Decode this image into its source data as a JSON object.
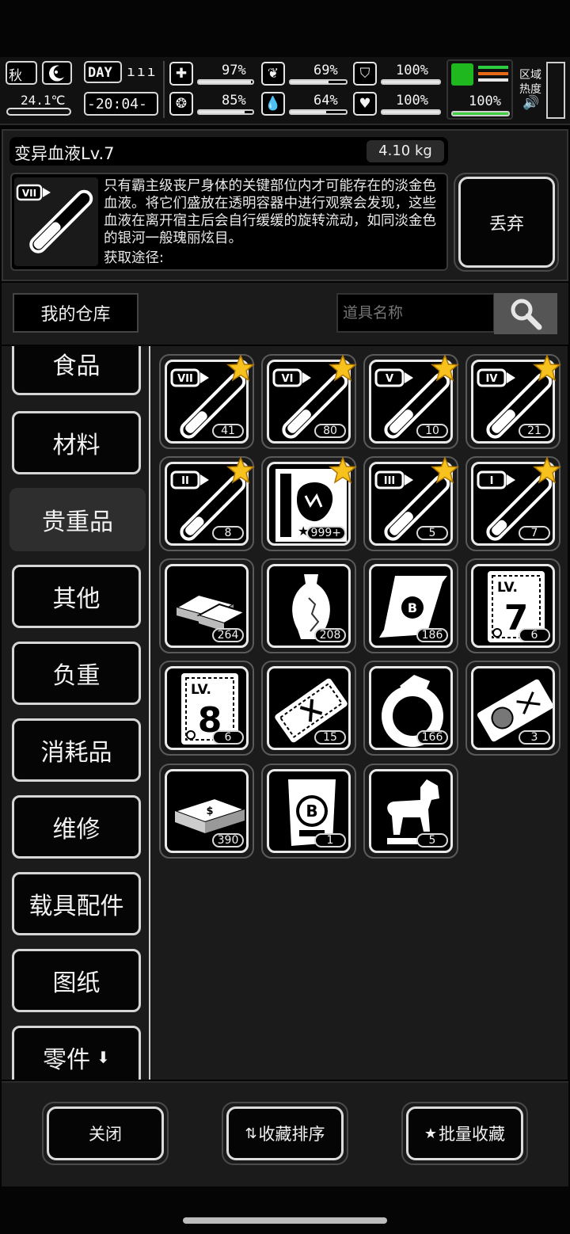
{
  "status": {
    "season": "秋",
    "temperature": "24.1℃",
    "day_label": "DAY",
    "time": "-20:04-",
    "health_pct": "97%",
    "hunger_pct": "69%",
    "sanity_pct": "85%",
    "thirst_pct": "64%",
    "armor_pct": "100%",
    "heart_pct": "100%",
    "stamina_pct": "100%",
    "region_label_1": "区域",
    "region_label_2": "热度",
    "health": 0.97,
    "hunger": 0.69,
    "sanity": 0.85,
    "thirst": 0.64,
    "armor": 1.0,
    "heart": 1.0,
    "stamina": 1.0
  },
  "item_detail": {
    "name": "变异血液Lv.7",
    "weight": "4.10 kg",
    "roman": "VII",
    "description": "只有霸主级丧尸身体的关键部位内才可能存在的淡金色血液。将它们盛放在透明容器中进行观察会发现，这些血液在离开宿主后会自行缓缓的旋转流动，如同淡金色的银河一般瑰丽炫目。",
    "source": "获取途径:",
    "discard_label": "丢弃"
  },
  "warehouse": {
    "title": "我的仓库",
    "search_placeholder": "道具名称"
  },
  "categories": [
    {
      "label": "食品"
    },
    {
      "label": "材料"
    },
    {
      "label": "贵重品"
    },
    {
      "label": "其他"
    },
    {
      "label": "负重"
    },
    {
      "label": "消耗品"
    },
    {
      "label": "维修"
    },
    {
      "label": "载具配件"
    },
    {
      "label": "图纸"
    },
    {
      "label": "零件"
    }
  ],
  "items": [
    {
      "icon": "blood-vial-icon",
      "roman": "VII",
      "count": "41",
      "fill": 0.55,
      "starred": true
    },
    {
      "icon": "blood-vial-icon",
      "roman": "VI",
      "count": "80",
      "fill": 0.6,
      "starred": true
    },
    {
      "icon": "blood-vial-icon",
      "roman": "V",
      "count": "10",
      "fill": 0.6,
      "starred": true
    },
    {
      "icon": "blood-vial-icon",
      "roman": "IV",
      "count": "21",
      "fill": 0.6,
      "starred": true
    },
    {
      "icon": "blood-vial-icon",
      "roman": "II",
      "count": "8",
      "fill": 0.45,
      "starred": true
    },
    {
      "icon": "poster-icon",
      "count": "999+",
      "starred": true
    },
    {
      "icon": "blood-vial-icon",
      "roman": "III",
      "count": "5",
      "fill": 0.6,
      "starred": true
    },
    {
      "icon": "blood-vial-icon",
      "roman": "I",
      "count": "7",
      "fill": 0.35,
      "starred": true
    },
    {
      "icon": "gold-bars-icon",
      "count": "264"
    },
    {
      "icon": "vase-icon",
      "count": "208"
    },
    {
      "icon": "scroll-icon",
      "count": "186"
    },
    {
      "icon": "lv7-card-icon",
      "card_level": "7",
      "card_prefix": "LV.",
      "count": "6"
    },
    {
      "icon": "lv8-card-icon",
      "card_level": "8",
      "card_prefix": "LV.",
      "count": "6"
    },
    {
      "icon": "ticket-icon",
      "count": "15"
    },
    {
      "icon": "ring-icon",
      "count": "166"
    },
    {
      "icon": "portrait-ticket-icon",
      "count": "3"
    },
    {
      "icon": "cash-stack-icon",
      "count": "390"
    },
    {
      "icon": "coin-poster-icon",
      "count": "1"
    },
    {
      "icon": "horse-statue-icon",
      "count": "5"
    }
  ],
  "footer": {
    "close_label": "关闭",
    "sort_label": "收藏排序",
    "batch_label": "批量收藏"
  }
}
